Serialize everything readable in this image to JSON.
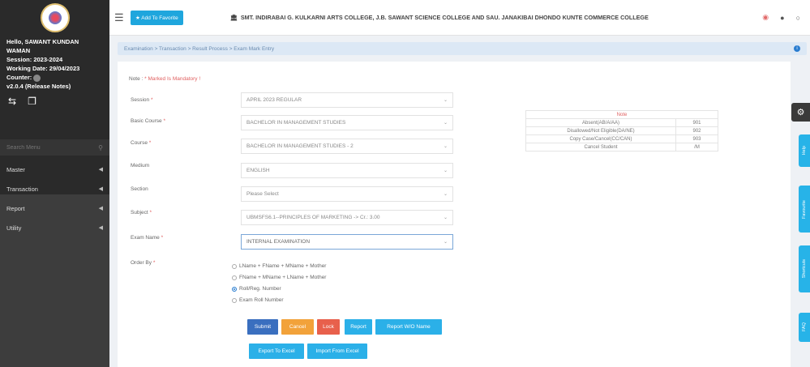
{
  "sidebar": {
    "greeting": "Hello, SAWANT KUNDAN WAMAN",
    "session": "Session: 2023-2024",
    "working_date": "Working Date: 29/04/2023",
    "counter": "Counter:",
    "version": "v2.0.4 (Release Notes)",
    "search_placeholder": "Search Menu",
    "items": [
      {
        "label": "Master"
      },
      {
        "label": "Transaction"
      },
      {
        "label": "Report"
      },
      {
        "label": "Utility"
      }
    ]
  },
  "header": {
    "add_favorite": "Add To Favorite",
    "college": "SMT. INDIRABAI G. KULKARNI ARTS COLLEGE, J.B. SAWANT SCIENCE COLLEGE AND SAU. JANAKIBAI DHONDO KUNTE COMMERCE COLLEGE"
  },
  "breadcrumb": "Examination > Transaction > Result Process > Exam Mark Entry",
  "form": {
    "note_prefix": "Note : ",
    "note_text": "* Marked Is Mandatory !",
    "fields": [
      {
        "label": "Session",
        "req": "*",
        "value": "APRIL 2023 REGULAR"
      },
      {
        "label": "Basic Course",
        "req": "*",
        "value": "BACHELOR IN MANAGEMENT STUDIES"
      },
      {
        "label": "Course",
        "req": "*",
        "value": "BACHELOR IN MANAGEMENT STUDIES - 2"
      },
      {
        "label": "Medium",
        "req": "",
        "value": "ENGLISH"
      },
      {
        "label": "Section",
        "req": "",
        "value": "Please Select"
      },
      {
        "label": "Subject",
        "req": "*",
        "value": "UBMSFS6.1--PRINCIPLES OF MARKETING -> Cr.: 3.00"
      },
      {
        "label": "Exam Name",
        "req": "*",
        "value": "INTERNAL EXAMINATION"
      }
    ],
    "order_label": "Order By",
    "order_req": "*",
    "order_options": [
      "LName + FName + MName + Mother",
      "FName + MName + LName + Mother",
      "Roll/Reg. Number",
      "Exam Roll Number"
    ],
    "buttons": {
      "submit": "Submit",
      "cancel": "Cancel",
      "lock": "Lock",
      "report": "Report",
      "report_wo_name": "Report W/O Name",
      "export_excel": "Export To Excel",
      "import_excel": "Import From Excel"
    }
  },
  "note_table": {
    "title": "Note",
    "rows": [
      {
        "label": "Absent(AB/A/AA)",
        "code": "901"
      },
      {
        "label": "Disallowed/Not Eligible(DA/NE)",
        "code": "902"
      },
      {
        "label": "Copy Case/Cancel(CC/CAN)",
        "code": "903"
      },
      {
        "label": "Cancel Student",
        "code": "/M"
      }
    ]
  },
  "side_tabs": [
    "Help",
    "Favourite",
    "Shortcuts",
    "FAQ"
  ]
}
